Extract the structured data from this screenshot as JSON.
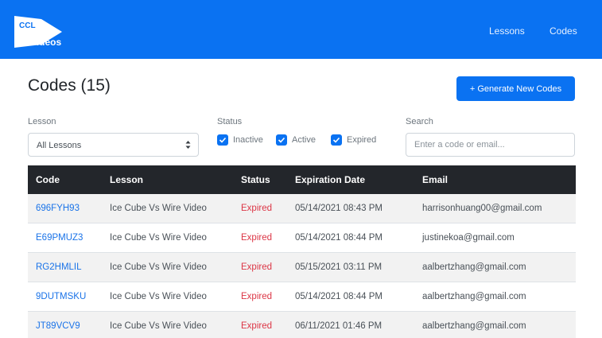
{
  "nav": {
    "logo_top": "CCL",
    "logo_bottom": "Videos",
    "links": [
      {
        "label": "Lessons"
      },
      {
        "label": "Codes"
      }
    ]
  },
  "header": {
    "title": "Codes (15)",
    "generate_label": "+ Generate New Codes"
  },
  "filters": {
    "lesson_label": "Lesson",
    "lesson_selected": "All Lessons",
    "status_label": "Status",
    "statuses": [
      {
        "label": "Inactive",
        "checked": true
      },
      {
        "label": "Active",
        "checked": true
      },
      {
        "label": "Expired",
        "checked": true
      }
    ],
    "search_label": "Search",
    "search_placeholder": "Enter a code or email..."
  },
  "table": {
    "columns": [
      "Code",
      "Lesson",
      "Status",
      "Expiration Date",
      "Email"
    ],
    "rows": [
      {
        "code": "696FYH93",
        "lesson": "Ice Cube Vs Wire Video",
        "status": "Expired",
        "date": "05/14/2021 08:43 PM",
        "email": "harrisonhuang00@gmail.com"
      },
      {
        "code": "E69PMUZ3",
        "lesson": "Ice Cube Vs Wire Video",
        "status": "Expired",
        "date": "05/14/2021 08:44 PM",
        "email": "justinekoa@gmail.com"
      },
      {
        "code": "RG2HMLIL",
        "lesson": "Ice Cube Vs Wire Video",
        "status": "Expired",
        "date": "05/15/2021 03:11 PM",
        "email": "aalbertzhang@gmail.com"
      },
      {
        "code": "9DUTMSKU",
        "lesson": "Ice Cube Vs Wire Video",
        "status": "Expired",
        "date": "05/14/2021 08:44 PM",
        "email": "aalbertzhang@gmail.com"
      },
      {
        "code": "JT89VCV9",
        "lesson": "Ice Cube Vs Wire Video",
        "status": "Expired",
        "date": "06/11/2021 01:46 PM",
        "email": "aalbertzhang@gmail.com"
      }
    ]
  },
  "colors": {
    "brand": "#0a72f2",
    "header_dark": "#23262b",
    "expired": "#dc3545",
    "link": "#1a73e8"
  }
}
